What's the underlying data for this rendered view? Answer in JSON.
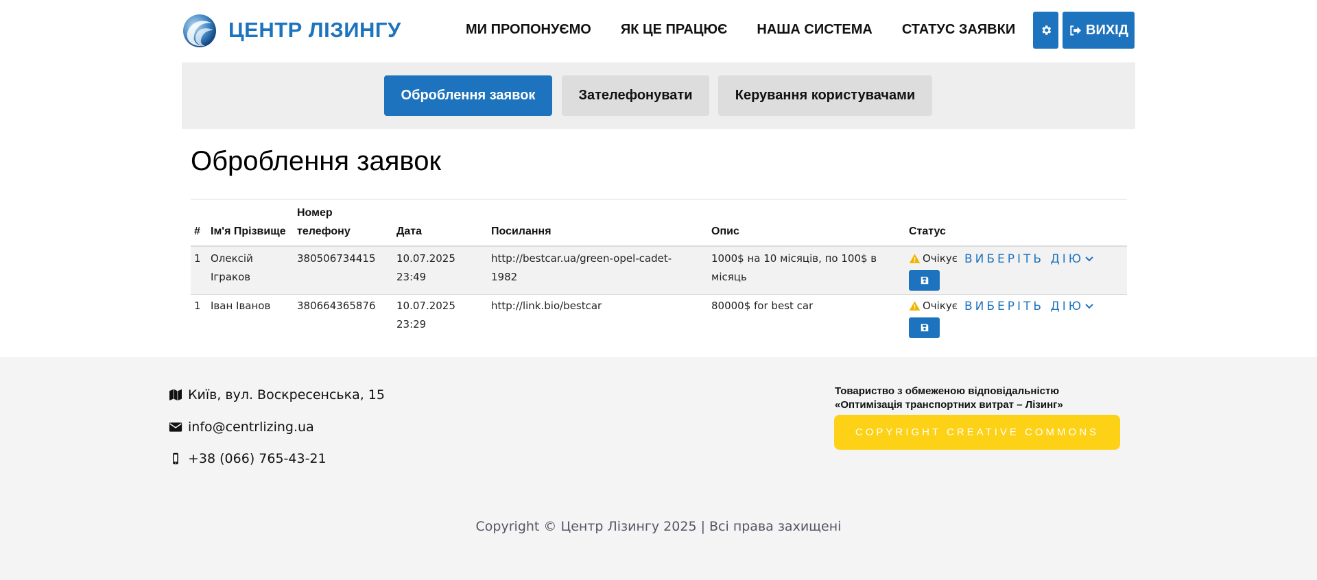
{
  "header": {
    "brand": "ЦЕНТР ЛІЗИНГУ",
    "nav": [
      "МИ ПРОПОНУЄМО",
      "ЯК ЦЕ ПРАЦЮЄ",
      "НАША СИСТЕМА",
      "СТАТУС ЗАЯВКИ"
    ],
    "exit_label": "ВИХІД",
    "icons": {
      "settings": "gear-icon",
      "exit": "sign-out-icon"
    }
  },
  "tabs": [
    "Оброблення заявок",
    "Зателефонувати",
    "Керування користувачами"
  ],
  "page_title": "Оброблення заявок",
  "table": {
    "headers": {
      "num": "#",
      "name": "Ім'я Прізвище",
      "phone_line1": "Номер",
      "phone_line2": "телефону",
      "date": "Дата",
      "link": "Посилання",
      "desc": "Опис",
      "status": "Статус"
    },
    "rows": [
      {
        "num": "1",
        "name_line1": "Олексій",
        "name_line2": "Ігракoв",
        "phone": "380506734415",
        "date_line1": "10.07.2025",
        "date_line2": "23:49",
        "link_line1": "http://bestcar.ua/green-opel-cadet-",
        "link_line2": "1982",
        "desc_line1": "1000$ на 10 місяців, по 100$ в",
        "desc_line2": "місяць",
        "status": "Очікує",
        "action": "ВИБЕРІТЬ ДІЮ"
      },
      {
        "num": "1",
        "name_line1": "Іван Іванов",
        "name_line2": "",
        "phone": "380664365876",
        "date_line1": "10.07.2025",
        "date_line2": "23:29",
        "link_line1": "http://link.bio/bestcar",
        "link_line2": "",
        "desc_line1": "80000$ for best car",
        "desc_line2": "",
        "status": "Очікує",
        "action": "ВИБЕРІТЬ ДІЮ"
      }
    ]
  },
  "footer": {
    "address": "Київ, вул. Воскресенська, 15",
    "email": "info@centrlizing.ua",
    "phone": "+38 (066) 765-43-21",
    "company_line1": "Товариство з обмеженою відповідальністю",
    "company_line2": "«Оптимізація транспортних витрат – Лізинг»",
    "cc_button": "COPYRIGHT CREATIVE COMMONS",
    "copyright": "Copyright © Центр Лізингу 2025 | Всі права захищені"
  },
  "colors": {
    "accent": "#1e73be",
    "warning": "#f0b400",
    "cc_yellow": "#fcd116",
    "footer_bg": "#f4f4f4",
    "tabs_bg": "#eeeeee"
  }
}
